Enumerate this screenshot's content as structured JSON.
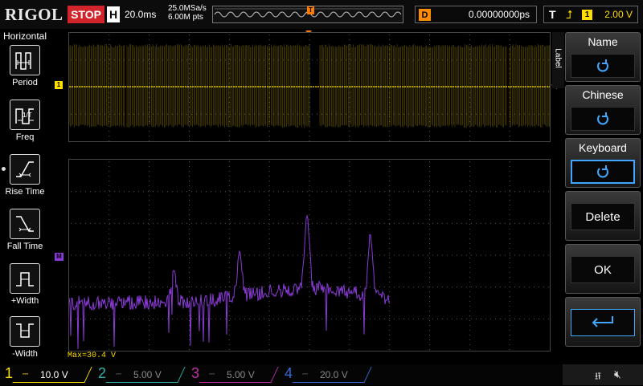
{
  "app": {
    "brand": "RIGOL",
    "run_state": "STOP"
  },
  "timebase": {
    "letter": "H",
    "scale": "20.0ms",
    "sample_rate": "25.0MSa/s",
    "memory_depth": "6.00M pts"
  },
  "delay": {
    "letter": "D",
    "value": "0.00000000ps"
  },
  "trigger": {
    "letter": "T",
    "edge": "rising",
    "source": "1",
    "level": "2.00 V"
  },
  "left_menu": {
    "title": "Horizontal",
    "items": [
      {
        "label": "Period",
        "icon": "period-icon"
      },
      {
        "label": "Freq",
        "icon": "frequency-icon"
      },
      {
        "label": "Rise Time",
        "icon": "rise-time-icon"
      },
      {
        "label": "Fall Time",
        "icon": "fall-time-icon"
      },
      {
        "label": "+Width",
        "icon": "positive-width-icon"
      },
      {
        "label": "-Width",
        "icon": "negative-width-icon"
      }
    ]
  },
  "right_menu": {
    "side_tab": "Label",
    "items": [
      {
        "label": "Name",
        "control": "knob-icon"
      },
      {
        "label": "Chinese",
        "control": "knob-icon"
      },
      {
        "label": "Keyboard",
        "control": "knob-icon"
      },
      {
        "label": "Delete"
      },
      {
        "label": "OK"
      },
      {
        "label": "",
        "control": "return-arrow-icon"
      }
    ]
  },
  "waveform": {
    "channel_marker": "1",
    "math_marker": "M",
    "math_max": "Max=30.4 V",
    "ch1_color": "#ffdd00",
    "math_color": "#8a3ad6"
  },
  "channels": [
    {
      "num": "1",
      "coupling": "⎓",
      "scale": "10.0 V",
      "color": "#ffdd00"
    },
    {
      "num": "2",
      "coupling": "⎓",
      "scale": "5.00 V",
      "color": "#2fb0a8"
    },
    {
      "num": "3",
      "coupling": "⎓",
      "scale": "5.00 V",
      "color": "#c02ea8"
    },
    {
      "num": "4",
      "coupling": "⎓",
      "scale": "20.0 V",
      "color": "#3a6ad6"
    }
  ],
  "status": {
    "usb_icon": "usb-icon",
    "sound_icon": "speaker-muted-icon"
  }
}
